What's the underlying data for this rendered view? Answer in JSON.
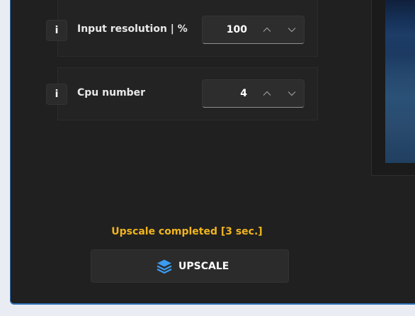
{
  "settings": [
    {
      "info_label": "i",
      "label": "Input resolution | %",
      "value": "100"
    },
    {
      "info_label": "i",
      "label": "Cpu number",
      "value": "4"
    }
  ],
  "status": {
    "text": "Upscale completed [3 sec.]",
    "color": "#f2b51f"
  },
  "upscale_button": {
    "label": "UPSCALE",
    "icon": "layers-icon"
  },
  "colors": {
    "accent": "#2d6fb8",
    "icon_blue": "#3b9cf1",
    "background": "#202020"
  }
}
